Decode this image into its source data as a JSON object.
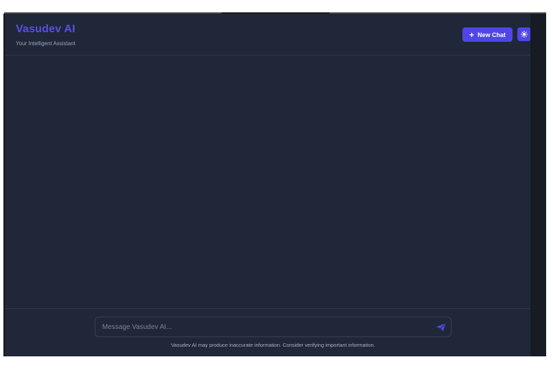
{
  "app": {
    "title": "Vasudev AI",
    "subtitle": "Your Intelligent Assistant"
  },
  "header": {
    "new_chat_label": "New Chat",
    "new_chat_icon": "plus-icon",
    "theme_toggle_icon": "sun-icon"
  },
  "composer": {
    "placeholder": "Message Vasudev AI...",
    "value": "",
    "send_icon": "paper-plane-icon"
  },
  "footer": {
    "disclaimer": "Vasudev AI may produce inaccurate information. Consider verifying important information."
  },
  "colors": {
    "accent": "#4f46e5",
    "brand_text": "#5b4ee6",
    "background": "#1f2739",
    "border": "#2f384b"
  }
}
